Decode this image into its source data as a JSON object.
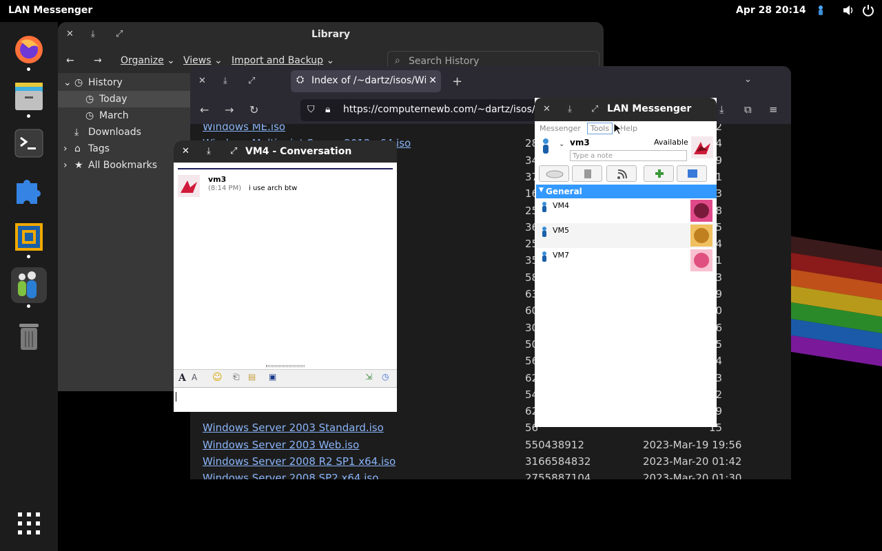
{
  "topbar": {
    "app_name": "LAN Messenger",
    "clock": "Apr 28  20:14",
    "icons": [
      "lan-messenger-tray-icon",
      "volume-icon",
      "power-icon"
    ]
  },
  "dock": {
    "apps": [
      "firefox-icon",
      "files-icon",
      "terminal-icon",
      "extensions-icon",
      "virtualbox-icon",
      "lan-messenger-icon",
      "trash-icon",
      "app-grid-icon"
    ]
  },
  "library": {
    "title": "Library",
    "menu": {
      "organize": "Organize",
      "views": "Views",
      "import_backup": "Import and Backup"
    },
    "search_placeholder": "Search History",
    "tree": {
      "history": "History",
      "today": "Today",
      "march": "March",
      "downloads": "Downloads",
      "tags": "Tags",
      "all_bookmarks": "All Bookmarks"
    }
  },
  "firefox": {
    "tab_title": "Index of /~dartz/isos/Win",
    "url": "https://computernewb.com/~dartz/isos/W",
    "rows": [
      {
        "name": "Windows ME.iso",
        "size": "",
        "date": "02"
      },
      {
        "name": "Windows Multipoint Server 2012 x64.iso",
        "size": "28",
        "date": "04"
      },
      {
        "name": "",
        "size": "34",
        "date": "09"
      },
      {
        "name": "",
        "size": "37",
        "date": "41"
      },
      {
        "name": "",
        "size": "16",
        "date": "53"
      },
      {
        "name": "",
        "size": "25",
        "date": "08"
      },
      {
        "name": "",
        "size": "36",
        "date": "25"
      },
      {
        "name": "",
        "size": "25",
        "date": "24"
      },
      {
        "name": "",
        "size": "35",
        "date": "11"
      },
      {
        "name": "",
        "size": "58",
        "date": "43"
      },
      {
        "name": "",
        "size": "63",
        "date": "09"
      },
      {
        "name": "",
        "size": "60",
        "date": "50"
      },
      {
        "name": "",
        "size": "30",
        "date": "16"
      },
      {
        "name": "",
        "size": "50",
        "date": "15"
      },
      {
        "name": "",
        "size": "56",
        "date": "14"
      },
      {
        "name": "",
        "size": "62",
        "date": "23"
      },
      {
        "name": "",
        "size": "54",
        "date": "02"
      },
      {
        "name": "",
        "size": "62",
        "date": "29"
      },
      {
        "name": "Windows Server 2003 Standard.iso",
        "size": "56",
        "date": "15"
      },
      {
        "name": "Windows Server 2003 Web.iso",
        "size": "550438912",
        "date": "2023-Mar-19 19:56"
      },
      {
        "name": "Windows Server 2008 R2 SP1 x64.iso",
        "size": "3166584832",
        "date": "2023-Mar-20 01:42"
      },
      {
        "name": "Windows Server 2008 SP2 x64.iso",
        "size": "2755887104",
        "date": "2023-Mar-20 01:30"
      }
    ]
  },
  "conversation": {
    "title": "VM4 - Conversation",
    "messages": [
      {
        "sender": "vm3",
        "time": "(8:14 PM)",
        "text": "i use arch btw"
      }
    ]
  },
  "lan": {
    "title": "LAN Messenger",
    "menu": {
      "messenger": "Messenger",
      "tools": "Tools",
      "help": "Help"
    },
    "user": {
      "name": "vm3",
      "status": "Available",
      "note_placeholder": "Type a note"
    },
    "group": "General",
    "buddies": [
      {
        "name": "VM4"
      },
      {
        "name": "VM5"
      },
      {
        "name": "VM7"
      }
    ]
  }
}
